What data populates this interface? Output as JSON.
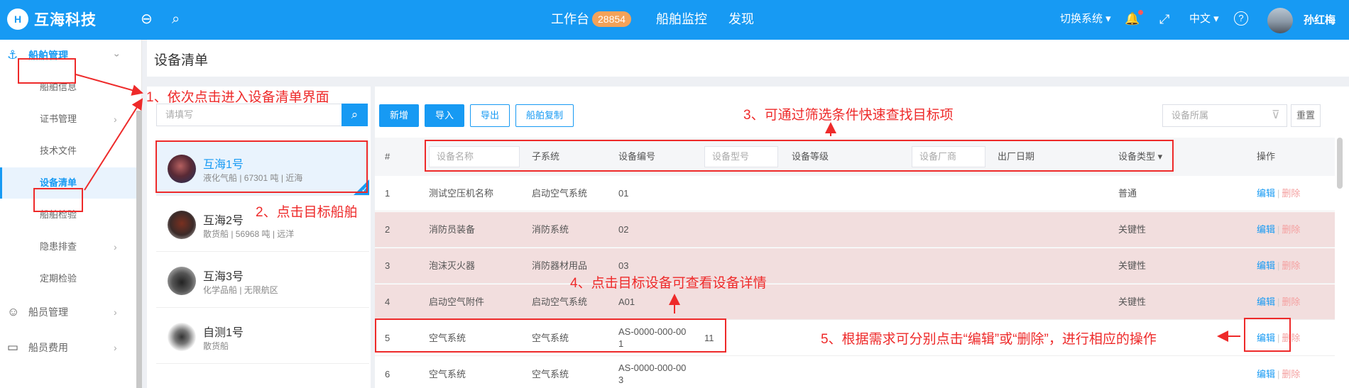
{
  "header": {
    "logo_mark": "H",
    "logo_text": "互海科技",
    "back_icon": "⊖",
    "search_icon": "⌕",
    "nav": [
      {
        "label": "工作台",
        "badge": "28854"
      },
      {
        "label": "船舶监控"
      },
      {
        "label": "发现"
      }
    ],
    "switch_system": "切换系统",
    "bell_icon": "🔔",
    "fullscreen_icon": "⤢",
    "lang": "中文",
    "help_icon": "?",
    "user_name": "孙红梅"
  },
  "sidebar": {
    "items": [
      {
        "label": "船舶管理",
        "type": "parent",
        "icon": "⚓"
      },
      {
        "label": "船舶信息"
      },
      {
        "label": "证书管理",
        "chevron": true
      },
      {
        "label": "技术文件"
      },
      {
        "label": "设备清单",
        "active": true
      },
      {
        "label": "船舶检验"
      },
      {
        "label": "隐患排查",
        "chevron": true
      },
      {
        "label": "定期检验"
      },
      {
        "label": "船员管理",
        "type": "top",
        "icon": "☺"
      },
      {
        "label": "船员费用",
        "type": "top",
        "icon": "▭"
      }
    ]
  },
  "page_title": "设备清单",
  "left_panel": {
    "search_placeholder": "请填写",
    "search_icon": "⌕",
    "ships": [
      {
        "name": "互海1号",
        "desc": "液化气船 | 67301 吨 | 近海",
        "selected": true
      },
      {
        "name": "互海2号",
        "desc": "散货船 | 56968 吨 | 远洋"
      },
      {
        "name": "互海3号",
        "desc": "化学品船 | 无限航区"
      },
      {
        "name": "自测1号",
        "desc": "散货船"
      }
    ]
  },
  "toolbar": {
    "add": "新增",
    "import": "导入",
    "export": "导出",
    "copy": "船舶复制",
    "filter_placeholder": "设备所属",
    "filter_icon": "⊽",
    "reset": "重置"
  },
  "table": {
    "headers": {
      "index": "#",
      "name_ph": "设备名称",
      "subsystem": "子系统",
      "code": "设备编号",
      "model_ph": "设备型号",
      "level": "设备等级",
      "maker_ph": "设备厂商",
      "date": "出厂日期",
      "type": "设备类型",
      "type_arrow": "▾",
      "ops": "操作"
    },
    "edit_label": "编辑",
    "sep": "|",
    "delete_label": "删除",
    "rows": [
      {
        "idx": "1",
        "name": "测试空压机名称",
        "sub": "启动空气系统",
        "code": "01",
        "model": "",
        "type": "普通",
        "hl": false
      },
      {
        "idx": "2",
        "name": "消防员装备",
        "sub": "消防系统",
        "code": "02",
        "model": "",
        "type": "关键性",
        "hl": true
      },
      {
        "idx": "3",
        "name": "泡沫灭火器",
        "sub": "消防器材用品",
        "code": "03",
        "model": "",
        "type": "关键性",
        "hl": true
      },
      {
        "idx": "4",
        "name": "启动空气附件",
        "sub": "启动空气系统",
        "code": "A01",
        "model": "",
        "type": "关键性",
        "hl": true
      },
      {
        "idx": "5",
        "name": "空气系统",
        "sub": "空气系统",
        "code_l1": "AS-0000-000-00",
        "code_l2": "1",
        "model": "11",
        "type": "",
        "hl": false
      },
      {
        "idx": "6",
        "name": "空气系统",
        "sub": "空气系统",
        "code_l1": "AS-0000-000-00",
        "code_l2": "3",
        "model": "",
        "type": "",
        "hl": false
      }
    ]
  },
  "annotations": {
    "a1": "1、依次点击进入设备清单界面",
    "a2": "2、点击目标船舶",
    "a3": "3、可通过筛选条件快速查找目标项",
    "a4": "4、点击目标设备可查看设备详情",
    "a5": "5、根据需求可分别点击“编辑”或“删除”，进行相应的操作"
  },
  "colors": {
    "primary": "#179af3",
    "annotation_red": "#ee2a2a",
    "row_highlight": "#f2dede",
    "badge": "#f4a259"
  }
}
